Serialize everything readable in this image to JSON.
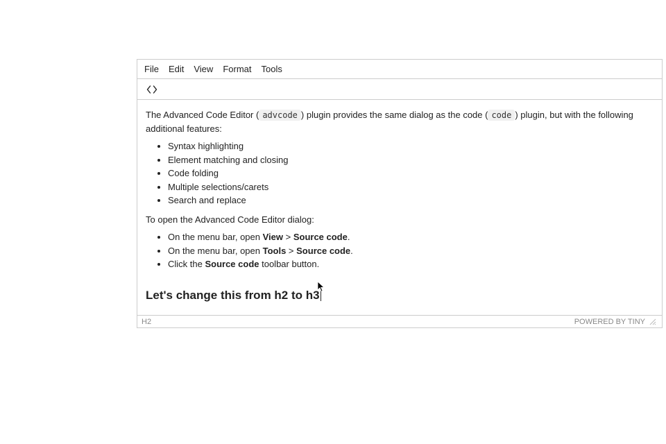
{
  "menu": {
    "file": "File",
    "edit": "Edit",
    "view": "View",
    "format": "Format",
    "tools": "Tools"
  },
  "intro": {
    "pre1": "The Advanced Code Editor (",
    "code1": "advcode",
    "mid": ") plugin provides the same dialog as the code (",
    "code2": "code",
    "post": ") plugin, but with the following additional features:"
  },
  "features": [
    "Syntax highlighting",
    "Element matching and closing",
    "Code folding",
    "Multiple selections/carets",
    "Search and replace"
  ],
  "open_intro": "To open the Advanced Code Editor dialog:",
  "steps": {
    "s1_pre": "On the menu bar, open ",
    "s1_b1": "View",
    "s1_sep": " > ",
    "s1_b2": "Source code",
    "s1_post": ".",
    "s2_pre": "On the menu bar, open ",
    "s2_b1": "Tools",
    "s2_sep": " > ",
    "s2_b2": "Source code",
    "s2_post": ".",
    "s3_pre": "Click the ",
    "s3_b1": "Source code",
    "s3_post": " toolbar button."
  },
  "heading": "Let's change this from h2 to h3",
  "status": {
    "path": "H2",
    "branding": "POWERED BY TINY"
  }
}
